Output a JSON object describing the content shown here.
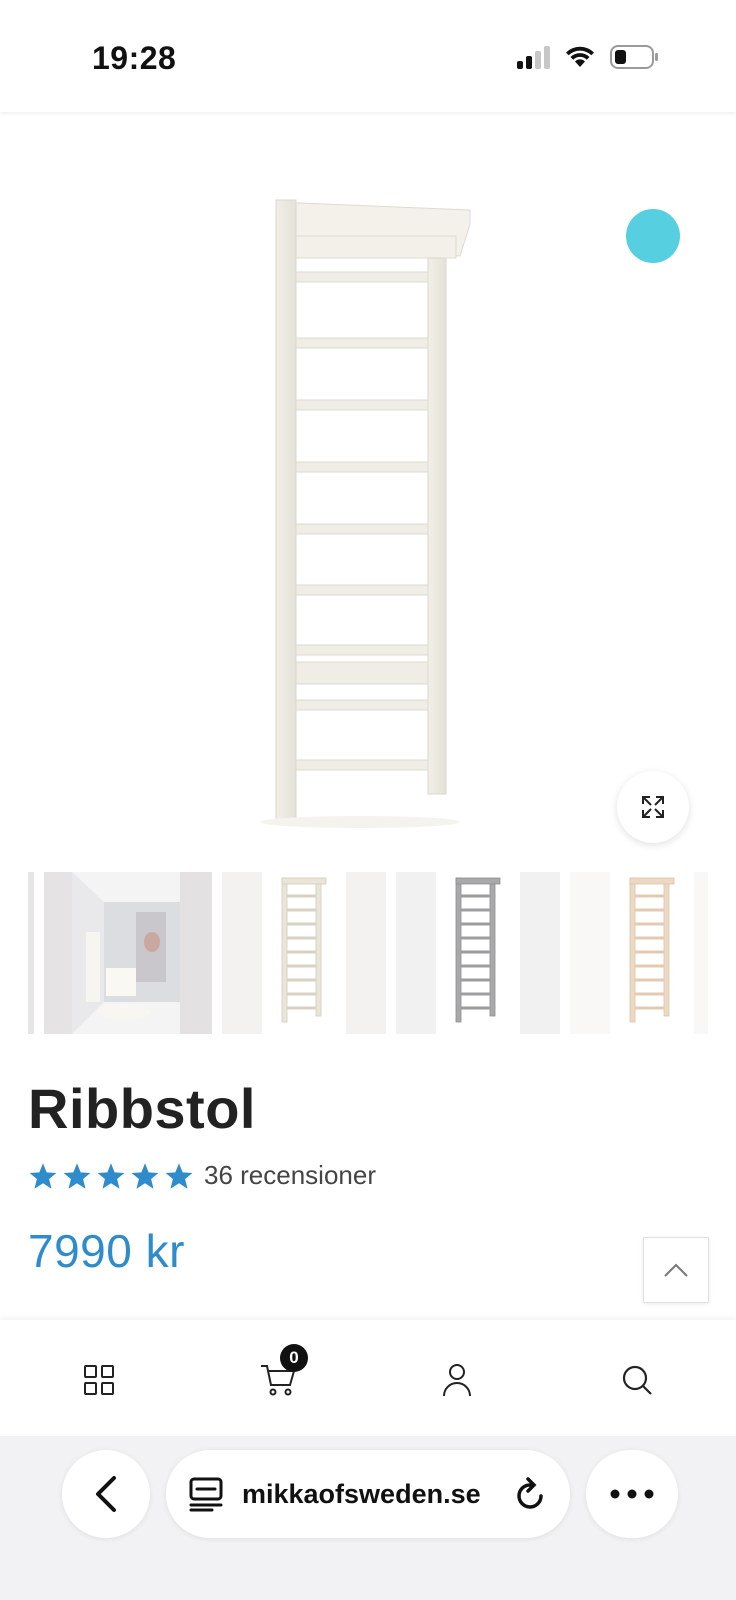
{
  "status_bar": {
    "time": "19:28"
  },
  "product": {
    "title": "Ribbstol",
    "rating_stars": 5,
    "rating_max": 5,
    "review_count_label": "36 recensioner",
    "price": "7990 kr",
    "color_swatch": "#56cfe1",
    "accent_color": "#2e8ccc"
  },
  "thumbnails": [
    {
      "name": "room-photo"
    },
    {
      "name": "wall-bars-white"
    },
    {
      "name": "wall-bars-grey"
    },
    {
      "name": "wall-bars-natural"
    }
  ],
  "tab_bar": {
    "items": [
      {
        "icon": "grid-icon"
      },
      {
        "icon": "cart-icon",
        "badge": "0"
      },
      {
        "icon": "account-icon"
      },
      {
        "icon": "search-icon"
      }
    ]
  },
  "browser": {
    "url": "mikkaofsweden.se",
    "back_icon": "chevron-left-icon",
    "reader_icon": "reader-icon",
    "reload_icon": "reload-icon",
    "more_icon": "more-dots-icon"
  }
}
